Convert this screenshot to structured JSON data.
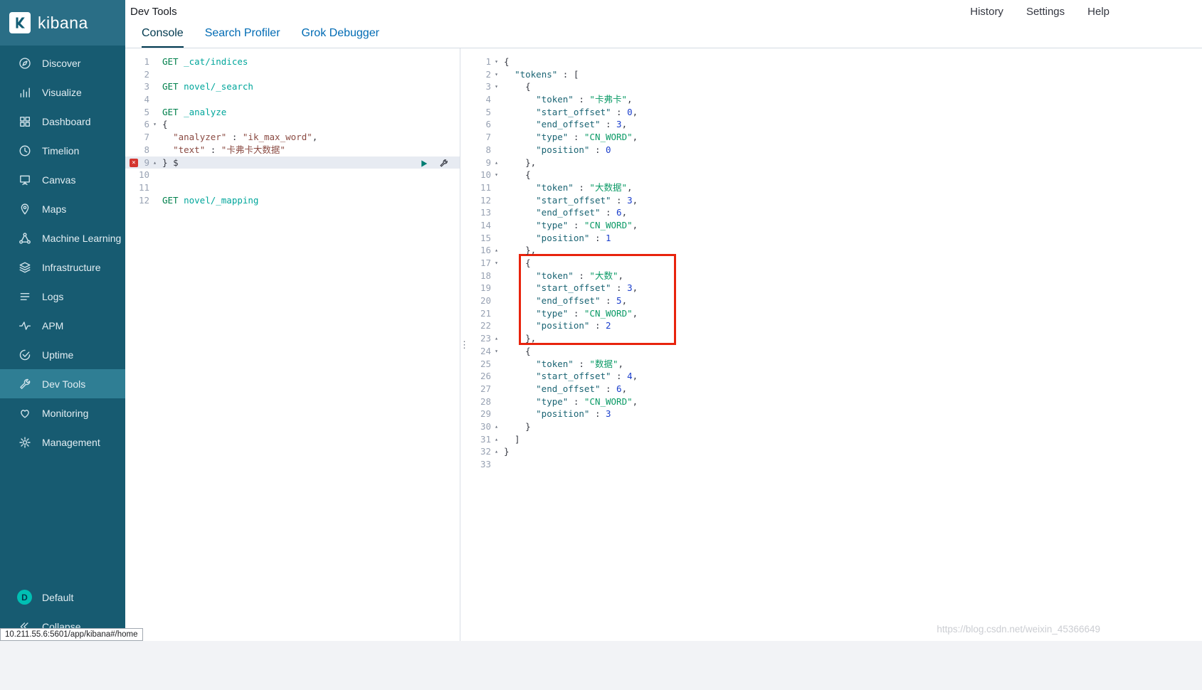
{
  "page": {
    "status_url": "10.211.55.6:5601/app/kibana#/home",
    "watermark": "https://blog.csdn.net/weixin_45366649"
  },
  "colors": {
    "sidebar_bg": "#175b71",
    "sidebar_active_bg": "#2f7e94",
    "link_blue": "#006bb4",
    "annotation_red": "#e8230d",
    "play_green": "#017d73",
    "error_red": "#d4352f",
    "avatar_teal": "#00bfb3"
  },
  "topbar": {
    "title": "Dev Tools",
    "links": [
      {
        "label": "History"
      },
      {
        "label": "Settings"
      },
      {
        "label": "Help"
      }
    ]
  },
  "tabs": [
    {
      "label": "Console",
      "active": true
    },
    {
      "label": "Search Profiler",
      "active": false
    },
    {
      "label": "Grok Debugger",
      "active": false
    }
  ],
  "sidebar": {
    "logo_text": "kibana",
    "items": [
      {
        "label": "Discover",
        "icon": "discover-icon"
      },
      {
        "label": "Visualize",
        "icon": "visualize-icon"
      },
      {
        "label": "Dashboard",
        "icon": "dashboard-icon"
      },
      {
        "label": "Timelion",
        "icon": "timelion-icon"
      },
      {
        "label": "Canvas",
        "icon": "canvas-icon"
      },
      {
        "label": "Maps",
        "icon": "maps-icon"
      },
      {
        "label": "Machine Learning",
        "icon": "machine-learning-icon"
      },
      {
        "label": "Infrastructure",
        "icon": "infrastructure-icon"
      },
      {
        "label": "Logs",
        "icon": "logs-icon"
      },
      {
        "label": "APM",
        "icon": "apm-icon"
      },
      {
        "label": "Uptime",
        "icon": "uptime-icon"
      },
      {
        "label": "Dev Tools",
        "icon": "dev-tools-icon",
        "active": true
      },
      {
        "label": "Monitoring",
        "icon": "monitoring-icon"
      },
      {
        "label": "Management",
        "icon": "management-icon"
      }
    ],
    "bottom": [
      {
        "label": "Default",
        "badge": "D"
      },
      {
        "label": "Collapse",
        "icon": "collapse-icon"
      }
    ]
  },
  "editor": {
    "lines": [
      {
        "n": 1,
        "s": [
          [
            "m",
            "GET"
          ],
          [
            "u",
            " _cat/indices"
          ]
        ]
      },
      {
        "n": 2,
        "s": []
      },
      {
        "n": 3,
        "s": [
          [
            "m",
            "GET"
          ],
          [
            "u",
            " novel/_search"
          ]
        ]
      },
      {
        "n": 4,
        "s": []
      },
      {
        "n": 5,
        "s": [
          [
            "m",
            "GET"
          ],
          [
            "u",
            " _analyze"
          ]
        ]
      },
      {
        "n": 6,
        "fold": "open",
        "s": [
          [
            "p",
            "{"
          ]
        ]
      },
      {
        "n": 7,
        "s": [
          [
            "p",
            "  "
          ],
          [
            "k",
            "\"analyzer\""
          ],
          [
            "p",
            " : "
          ],
          [
            "s",
            "\"ik_max_word\""
          ],
          [
            "p",
            ","
          ]
        ]
      },
      {
        "n": 8,
        "s": [
          [
            "p",
            "  "
          ],
          [
            "k",
            "\"text\""
          ],
          [
            "p",
            " : "
          ],
          [
            "s",
            "\"卡弗卡大数据\""
          ]
        ]
      },
      {
        "n": 9,
        "fold": "close",
        "active": true,
        "error": true,
        "actions": [
          "play-icon",
          "wrench-icon"
        ],
        "s": [
          [
            "p",
            "} "
          ],
          [
            "c",
            "$"
          ]
        ]
      },
      {
        "n": 10,
        "s": []
      },
      {
        "n": 11,
        "s": []
      },
      {
        "n": 12,
        "s": [
          [
            "m",
            "GET"
          ],
          [
            "u",
            " novel/_mapping"
          ]
        ]
      }
    ]
  },
  "response": {
    "annotation": {
      "shape": "rectangle",
      "color": "#e8230d",
      "covers_lines": "17-23"
    },
    "lines": [
      {
        "n": 1,
        "fold": "open",
        "s": [
          [
            "p",
            "{"
          ]
        ]
      },
      {
        "n": 2,
        "fold": "open",
        "s": [
          [
            "p",
            "  "
          ],
          [
            "K",
            "\"tokens\""
          ],
          [
            "p",
            " : ["
          ]
        ]
      },
      {
        "n": 3,
        "fold": "open",
        "s": [
          [
            "p",
            "    {"
          ]
        ]
      },
      {
        "n": 4,
        "s": [
          [
            "p",
            "      "
          ],
          [
            "K",
            "\"token\""
          ],
          [
            "p",
            " : "
          ],
          [
            "S",
            "\"卡弗卡\""
          ],
          [
            "p",
            ","
          ]
        ]
      },
      {
        "n": 5,
        "s": [
          [
            "p",
            "      "
          ],
          [
            "K",
            "\"start_offset\""
          ],
          [
            "p",
            " : "
          ],
          [
            "N",
            "0"
          ],
          [
            "p",
            ","
          ]
        ]
      },
      {
        "n": 6,
        "s": [
          [
            "p",
            "      "
          ],
          [
            "K",
            "\"end_offset\""
          ],
          [
            "p",
            " : "
          ],
          [
            "N",
            "3"
          ],
          [
            "p",
            ","
          ]
        ]
      },
      {
        "n": 7,
        "s": [
          [
            "p",
            "      "
          ],
          [
            "K",
            "\"type\""
          ],
          [
            "p",
            " : "
          ],
          [
            "S",
            "\"CN_WORD\""
          ],
          [
            "p",
            ","
          ]
        ]
      },
      {
        "n": 8,
        "s": [
          [
            "p",
            "      "
          ],
          [
            "K",
            "\"position\""
          ],
          [
            "p",
            " : "
          ],
          [
            "N",
            "0"
          ]
        ]
      },
      {
        "n": 9,
        "fold": "close",
        "s": [
          [
            "p",
            "    },"
          ]
        ]
      },
      {
        "n": 10,
        "fold": "open",
        "s": [
          [
            "p",
            "    {"
          ]
        ]
      },
      {
        "n": 11,
        "s": [
          [
            "p",
            "      "
          ],
          [
            "K",
            "\"token\""
          ],
          [
            "p",
            " : "
          ],
          [
            "S",
            "\"大数据\""
          ],
          [
            "p",
            ","
          ]
        ]
      },
      {
        "n": 12,
        "s": [
          [
            "p",
            "      "
          ],
          [
            "K",
            "\"start_offset\""
          ],
          [
            "p",
            " : "
          ],
          [
            "N",
            "3"
          ],
          [
            "p",
            ","
          ]
        ]
      },
      {
        "n": 13,
        "s": [
          [
            "p",
            "      "
          ],
          [
            "K",
            "\"end_offset\""
          ],
          [
            "p",
            " : "
          ],
          [
            "N",
            "6"
          ],
          [
            "p",
            ","
          ]
        ]
      },
      {
        "n": 14,
        "s": [
          [
            "p",
            "      "
          ],
          [
            "K",
            "\"type\""
          ],
          [
            "p",
            " : "
          ],
          [
            "S",
            "\"CN_WORD\""
          ],
          [
            "p",
            ","
          ]
        ]
      },
      {
        "n": 15,
        "s": [
          [
            "p",
            "      "
          ],
          [
            "K",
            "\"position\""
          ],
          [
            "p",
            " : "
          ],
          [
            "N",
            "1"
          ]
        ]
      },
      {
        "n": 16,
        "fold": "close",
        "s": [
          [
            "p",
            "    },"
          ]
        ]
      },
      {
        "n": 17,
        "fold": "open",
        "s": [
          [
            "p",
            "    {"
          ]
        ]
      },
      {
        "n": 18,
        "s": [
          [
            "p",
            "      "
          ],
          [
            "K",
            "\"token\""
          ],
          [
            "p",
            " : "
          ],
          [
            "S",
            "\"大数\""
          ],
          [
            "p",
            ","
          ]
        ]
      },
      {
        "n": 19,
        "s": [
          [
            "p",
            "      "
          ],
          [
            "K",
            "\"start_offset\""
          ],
          [
            "p",
            " : "
          ],
          [
            "N",
            "3"
          ],
          [
            "p",
            ","
          ]
        ]
      },
      {
        "n": 20,
        "s": [
          [
            "p",
            "      "
          ],
          [
            "K",
            "\"end_offset\""
          ],
          [
            "p",
            " : "
          ],
          [
            "N",
            "5"
          ],
          [
            "p",
            ","
          ]
        ]
      },
      {
        "n": 21,
        "s": [
          [
            "p",
            "      "
          ],
          [
            "K",
            "\"type\""
          ],
          [
            "p",
            " : "
          ],
          [
            "S",
            "\"CN_WORD\""
          ],
          [
            "p",
            ","
          ]
        ]
      },
      {
        "n": 22,
        "s": [
          [
            "p",
            "      "
          ],
          [
            "K",
            "\"position\""
          ],
          [
            "p",
            " : "
          ],
          [
            "N",
            "2"
          ]
        ]
      },
      {
        "n": 23,
        "fold": "close",
        "s": [
          [
            "p",
            "    },"
          ]
        ]
      },
      {
        "n": 24,
        "fold": "open",
        "s": [
          [
            "p",
            "    {"
          ]
        ]
      },
      {
        "n": 25,
        "s": [
          [
            "p",
            "      "
          ],
          [
            "K",
            "\"token\""
          ],
          [
            "p",
            " : "
          ],
          [
            "S",
            "\"数据\""
          ],
          [
            "p",
            ","
          ]
        ]
      },
      {
        "n": 26,
        "s": [
          [
            "p",
            "      "
          ],
          [
            "K",
            "\"start_offset\""
          ],
          [
            "p",
            " : "
          ],
          [
            "N",
            "4"
          ],
          [
            "p",
            ","
          ]
        ]
      },
      {
        "n": 27,
        "s": [
          [
            "p",
            "      "
          ],
          [
            "K",
            "\"end_offset\""
          ],
          [
            "p",
            " : "
          ],
          [
            "N",
            "6"
          ],
          [
            "p",
            ","
          ]
        ]
      },
      {
        "n": 28,
        "s": [
          [
            "p",
            "      "
          ],
          [
            "K",
            "\"type\""
          ],
          [
            "p",
            " : "
          ],
          [
            "S",
            "\"CN_WORD\""
          ],
          [
            "p",
            ","
          ]
        ]
      },
      {
        "n": 29,
        "s": [
          [
            "p",
            "      "
          ],
          [
            "K",
            "\"position\""
          ],
          [
            "p",
            " : "
          ],
          [
            "N",
            "3"
          ]
        ]
      },
      {
        "n": 30,
        "fold": "close",
        "s": [
          [
            "p",
            "    }"
          ]
        ]
      },
      {
        "n": 31,
        "fold": "close",
        "s": [
          [
            "p",
            "  ]"
          ]
        ]
      },
      {
        "n": 32,
        "fold": "close",
        "s": [
          [
            "p",
            "}"
          ]
        ]
      },
      {
        "n": 33,
        "s": []
      }
    ]
  }
}
